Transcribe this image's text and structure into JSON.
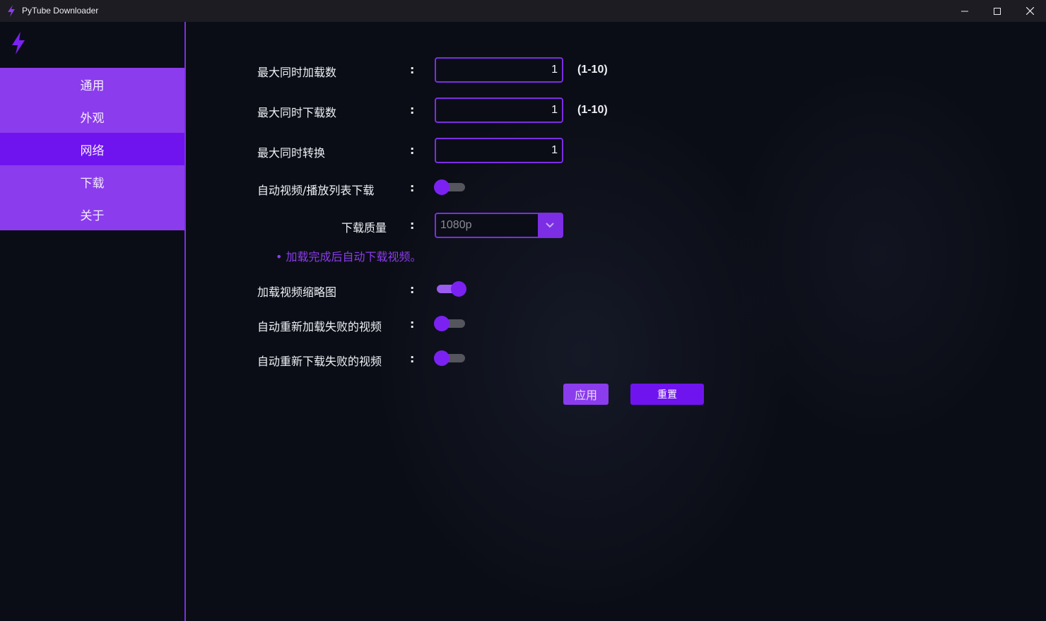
{
  "window": {
    "title": "PyTube Downloader",
    "controls": [
      "minimize-icon",
      "maximize-icon",
      "close-icon"
    ]
  },
  "colors": {
    "accent": "#7b2ee3",
    "nav_bg": "#8b3ced",
    "nav_active": "#6f14ef",
    "bg": "#0b0d16"
  },
  "sidebar": {
    "logo": "lightning-icon",
    "items": [
      {
        "label": "通用",
        "active": false
      },
      {
        "label": "外观",
        "active": false
      },
      {
        "label": "网络",
        "active": true
      },
      {
        "label": "下载",
        "active": false
      },
      {
        "label": "关于",
        "active": false
      }
    ]
  },
  "settings": {
    "colon": ":",
    "max_load": {
      "label": "最大同时加载数",
      "value": "1",
      "range": "(1-10)"
    },
    "max_download": {
      "label": "最大同时下载数",
      "value": "1",
      "range": "(1-10)"
    },
    "max_convert": {
      "label": "最大同时转换",
      "value": "1"
    },
    "auto_download": {
      "label": "自动视频/播放列表下载",
      "enabled": false
    },
    "quality": {
      "label": "下载质量",
      "value": "1080p"
    },
    "hint": "• 加载完成后自动下载视频。",
    "load_thumbnails": {
      "label": "加载视频缩略图",
      "enabled": true
    },
    "auto_reload": {
      "label": "自动重新加载失败的视频",
      "enabled": false
    },
    "auto_redownload": {
      "label": "自动重新下载失败的视频",
      "enabled": false
    }
  },
  "buttons": {
    "apply": "应用",
    "reset": "重置"
  }
}
